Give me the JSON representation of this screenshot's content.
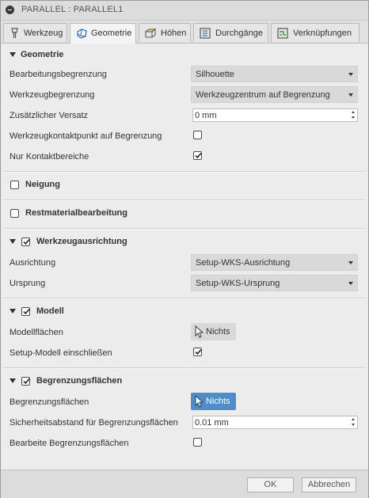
{
  "window": {
    "title": "PARALLEL : PARALLEL1"
  },
  "tabs": [
    {
      "label": "Werkzeug",
      "icon": "tool-icon"
    },
    {
      "label": "Geometrie",
      "icon": "geometry-cube-icon",
      "active": true
    },
    {
      "label": "Höhen",
      "icon": "heights-box-icon"
    },
    {
      "label": "Durchgänge",
      "icon": "passes-icon"
    },
    {
      "label": "Verknüpfungen",
      "icon": "linking-icon"
    }
  ],
  "geometrie": {
    "title": "Geometrie",
    "bearbeitungsbegrenzung": {
      "label": "Bearbeitungsbegrenzung",
      "value": "Silhouette"
    },
    "werkzeugbegrenzung": {
      "label": "Werkzeugbegrenzung",
      "value": "Werkzeugzentrum auf Begrenzung"
    },
    "versatz": {
      "label": "Zusätzlicher Versatz",
      "value": "0 mm"
    },
    "kontaktpunkt": {
      "label": "Werkzeugkontaktpunkt auf Begrenzung",
      "checked": false
    },
    "kontaktbereiche": {
      "label": "Nur Kontaktbereiche",
      "checked": true
    }
  },
  "neigung": {
    "title": "Neigung",
    "checked": false
  },
  "restmaterial": {
    "title": "Restmaterialbearbeitung",
    "checked": false
  },
  "ausrichtung": {
    "title": "Werkzeugausrichtung",
    "checked": true,
    "ausrichtung": {
      "label": "Ausrichtung",
      "value": "Setup-WKS-Ausrichtung"
    },
    "ursprung": {
      "label": "Ursprung",
      "value": "Setup-WKS-Ursprung"
    }
  },
  "modell": {
    "title": "Modell",
    "checked": true,
    "flaechen": {
      "label": "Modellflächen",
      "button": "Nichts"
    },
    "setup": {
      "label": "Setup-Modell einschließen",
      "checked": true
    }
  },
  "begrenzung": {
    "title": "Begrenzungsflächen",
    "checked": true,
    "flaechen": {
      "label": "Begrenzungsflächen",
      "button": "Nichts"
    },
    "abstand": {
      "label": "Sicherheitsabstand für Begrenzungsflächen",
      "value": "0.01 mm"
    },
    "bearbeite": {
      "label": "Bearbeite Begrenzungsflächen",
      "checked": false
    }
  },
  "footer": {
    "ok": "OK",
    "cancel": "Abbrechen"
  },
  "colors": {
    "accent": "#4f8dc9",
    "panel": "#ececec"
  }
}
